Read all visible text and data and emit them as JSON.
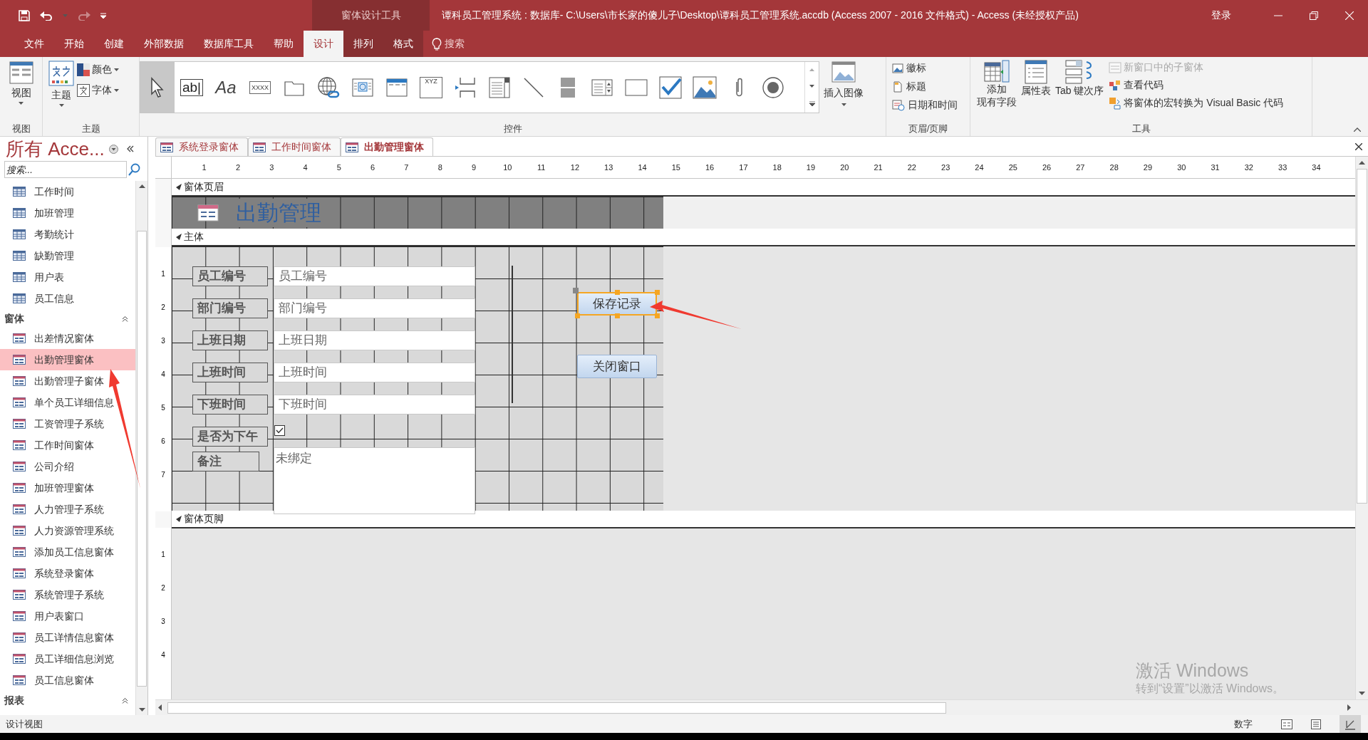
{
  "title_bar": {
    "context_title": "窗体设计工具",
    "title": "谭科员工管理系统 : 数据库- C:\\Users\\市长家的傻儿子\\Desktop\\谭科员工管理系统.accdb (Access 2007 - 2016 文件格式)  -  Access (未经授权产品)",
    "sign_in": "登录"
  },
  "menu_tabs": [
    {
      "label": "文件",
      "selected": false,
      "contextual": false
    },
    {
      "label": "开始",
      "selected": false,
      "contextual": false
    },
    {
      "label": "创建",
      "selected": false,
      "contextual": false
    },
    {
      "label": "外部数据",
      "selected": false,
      "contextual": false
    },
    {
      "label": "数据库工具",
      "selected": false,
      "contextual": false
    },
    {
      "label": "帮助",
      "selected": false,
      "contextual": false
    },
    {
      "label": "设计",
      "selected": true,
      "contextual": true
    },
    {
      "label": "排列",
      "selected": false,
      "contextual": true
    },
    {
      "label": "格式",
      "selected": false,
      "contextual": true
    }
  ],
  "tell_me": {
    "placeholder": "搜索"
  },
  "ribbon": {
    "view": {
      "label": "视图",
      "group": "视图"
    },
    "theme": {
      "group": "主题",
      "theme_label": "主题",
      "colors_label": "颜色",
      "fonts_label": "字体"
    },
    "controls": {
      "group": "控件",
      "tools": [
        {
          "kind": "select",
          "selected": true
        },
        {
          "kind": "textbox",
          "glyph": "ab|",
          "selected": false
        },
        {
          "kind": "label",
          "glyph": "Aa",
          "selected": false
        },
        {
          "kind": "button",
          "glyph": "XXXX",
          "selected": false
        },
        {
          "kind": "tab",
          "selected": false
        },
        {
          "kind": "hyperlink",
          "selected": false
        },
        {
          "kind": "web",
          "selected": false
        },
        {
          "kind": "navigation",
          "selected": false
        },
        {
          "kind": "group",
          "glyph": "XYZ",
          "selected": false
        },
        {
          "kind": "pagebreak",
          "selected": false
        },
        {
          "kind": "combo",
          "selected": false
        },
        {
          "kind": "line",
          "selected": false
        },
        {
          "kind": "toggle",
          "selected": false
        },
        {
          "kind": "list",
          "selected": false
        },
        {
          "kind": "rect",
          "selected": false
        },
        {
          "kind": "checkbox",
          "selected": false
        },
        {
          "kind": "image",
          "selected": false
        },
        {
          "kind": "attachment",
          "selected": false
        },
        {
          "kind": "radio",
          "selected": false
        }
      ],
      "insert_image": "插入图像"
    },
    "header_footer": {
      "group": "页眉/页脚",
      "items": [
        {
          "kind": "logo",
          "label": "徽标"
        },
        {
          "kind": "title",
          "label": "标题"
        },
        {
          "kind": "datetime",
          "label": "日期和时间"
        }
      ]
    },
    "tools": {
      "group": "工具",
      "large": [
        {
          "kind": "fields",
          "lines": [
            "添加",
            "现有字段"
          ]
        },
        {
          "kind": "sheet",
          "lines": [
            "属性表"
          ]
        },
        {
          "kind": "taborder",
          "lines": [
            "Tab 键次序"
          ]
        }
      ],
      "small": [
        {
          "kind": "subform",
          "label": "新窗口中的子窗体",
          "disabled": true
        },
        {
          "kind": "code",
          "label": "查看代码",
          "disabled": false
        },
        {
          "kind": "macro",
          "label": "将窗体的宏转换为 Visual Basic 代码",
          "disabled": false
        }
      ]
    }
  },
  "nav": {
    "title": "所有 Acce...",
    "search_placeholder": "搜索...",
    "groups": [
      {
        "items": [
          {
            "kind": "table",
            "label": "工作时间",
            "selected": false
          },
          {
            "kind": "table",
            "label": "加班管理",
            "selected": false
          },
          {
            "kind": "table",
            "label": "考勤统计",
            "selected": false
          },
          {
            "kind": "table",
            "label": "缺勤管理",
            "selected": false
          },
          {
            "kind": "table",
            "label": "用户表",
            "selected": false
          },
          {
            "kind": "table",
            "label": "员工信息",
            "selected": false
          }
        ]
      },
      {
        "title": "窗体",
        "expanded": true,
        "items": [
          {
            "kind": "form",
            "label": "出差情况窗体",
            "selected": false
          },
          {
            "kind": "form",
            "label": "出勤管理窗体",
            "selected": true
          },
          {
            "kind": "form",
            "label": "出勤管理子窗体",
            "selected": false
          },
          {
            "kind": "form",
            "label": "单个员工详细信息",
            "selected": false
          },
          {
            "kind": "form",
            "label": "工资管理子系统",
            "selected": false
          },
          {
            "kind": "form",
            "label": "工作时间窗体",
            "selected": false
          },
          {
            "kind": "form",
            "label": "公司介绍",
            "selected": false
          },
          {
            "kind": "form",
            "label": "加班管理窗体",
            "selected": false
          },
          {
            "kind": "form",
            "label": "人力管理子系统",
            "selected": false
          },
          {
            "kind": "form",
            "label": "人力资源管理系统",
            "selected": false
          },
          {
            "kind": "form",
            "label": "添加员工信息窗体",
            "selected": false
          },
          {
            "kind": "form",
            "label": "系统登录窗体",
            "selected": false
          },
          {
            "kind": "form",
            "label": "系统管理子系统",
            "selected": false
          },
          {
            "kind": "form",
            "label": "用户表窗口",
            "selected": false
          },
          {
            "kind": "form",
            "label": "员工详情信息窗体",
            "selected": false
          },
          {
            "kind": "form",
            "label": "员工详细信息浏览",
            "selected": false
          },
          {
            "kind": "form",
            "label": "员工信息窗体",
            "selected": false
          }
        ]
      },
      {
        "title": "报表",
        "expanded": true
      }
    ]
  },
  "doc_tabs": [
    {
      "label": "系统登录窗体",
      "selected": false
    },
    {
      "label": "工作时间窗体",
      "selected": false
    },
    {
      "label": "出勤管理窗体",
      "selected": true
    }
  ],
  "ruler": [
    "1",
    "2",
    "3",
    "4",
    "5",
    "6",
    "7",
    "8",
    "9",
    "10",
    "11",
    "12",
    "13",
    "14",
    "15",
    "16",
    "17",
    "18",
    "19",
    "20",
    "21",
    "22",
    "23",
    "24",
    "25",
    "26",
    "27",
    "28",
    "29",
    "30",
    "31",
    "32",
    "33",
    "34"
  ],
  "vertical_ruler": {
    "detail": [
      "1",
      "2",
      "3",
      "4",
      "5",
      "6",
      "7"
    ],
    "footer": [
      "1",
      "2",
      "3",
      "4"
    ]
  },
  "form": {
    "header": {
      "band": "窗体页眉",
      "title": "出勤管理"
    },
    "detail": {
      "band": "主体",
      "fields": [
        {
          "kind": "textbox",
          "label": "员工编号",
          "value": "员工编号"
        },
        {
          "kind": "textbox",
          "label": "部门编号",
          "value": "部门编号"
        },
        {
          "kind": "textbox",
          "label": "上班日期",
          "value": "上班日期"
        },
        {
          "kind": "textbox",
          "label": "上班时间",
          "value": "上班时间"
        },
        {
          "kind": "textbox",
          "label": "下班时间",
          "value": "下班时间"
        },
        {
          "kind": "checkbox",
          "label": "是否为下午",
          "checked": true
        },
        {
          "kind": "memo",
          "label": "备注",
          "value": "未绑定"
        }
      ],
      "buttons": [
        {
          "label": "保存记录",
          "selected": true
        },
        {
          "label": "关闭窗口",
          "selected": false
        }
      ]
    },
    "footer": {
      "band": "窗体页脚"
    }
  },
  "activation_notice": {
    "title": "激活 Windows",
    "text": "转到“设置”以激活 Windows。"
  },
  "status_bar": {
    "left": "设计视图",
    "right": "数字"
  }
}
